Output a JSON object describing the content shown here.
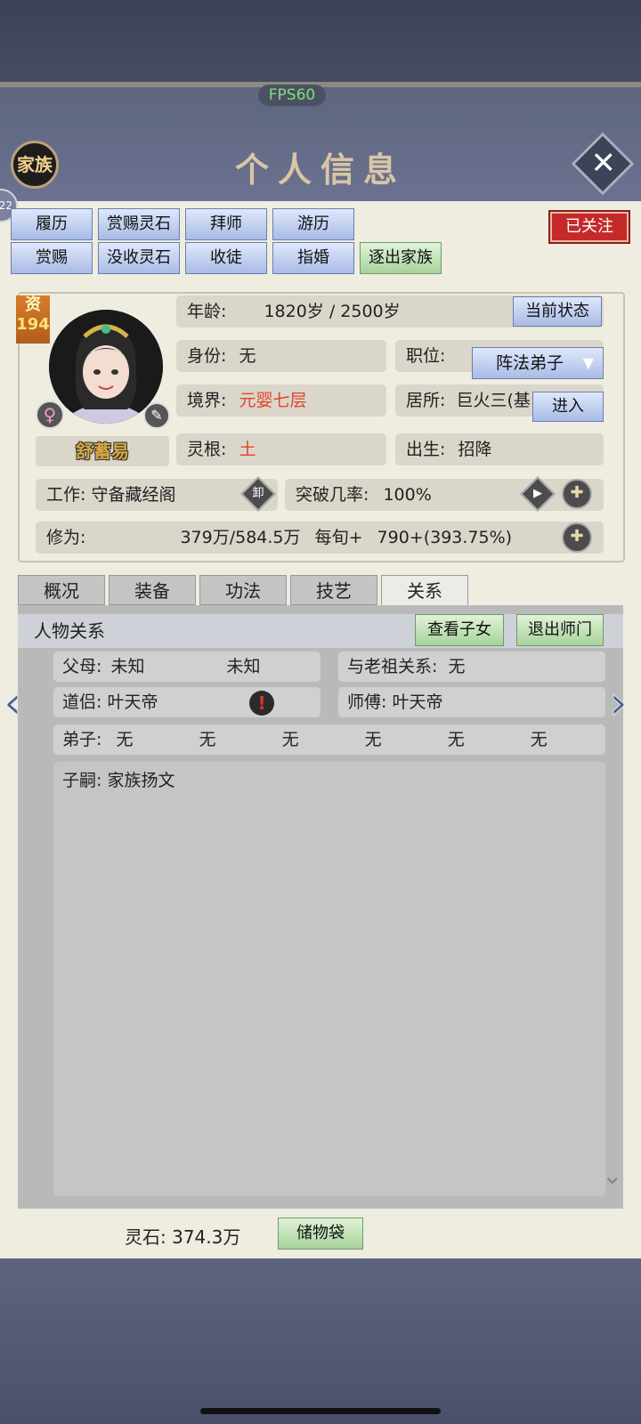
{
  "fps": "FPS60",
  "header": {
    "family_label": "家族",
    "title": "个人信息"
  },
  "side_badge": "22",
  "action_buttons_row1": [
    "履历",
    "赏赐灵石",
    "拜师",
    "游历"
  ],
  "action_buttons_row2": [
    "赏赐",
    "没收灵石",
    "收徒",
    "指婚",
    "逐出家族"
  ],
  "followed_label": "已关注",
  "character": {
    "zi_label": "资",
    "zi_value": "194",
    "gender_icon": "female-icon",
    "name": "舒蓄易",
    "age_label": "年龄:",
    "age_value": "1820岁 / 2500岁",
    "status_button": "当前状态",
    "identity_label": "身份:",
    "identity_value": "无",
    "position_label": "职位:",
    "position_value": "阵法弟子",
    "realm_label": "境界:",
    "realm_value": "元婴七层",
    "residence_label": "居所:",
    "residence_value": "巨火三(基",
    "enter_button": "进入",
    "root_label": "灵根:",
    "root_value": "土",
    "birth_label": "出生:",
    "birth_value": "招降",
    "work_label": "工作:",
    "work_value": "守备藏经阁",
    "work_icon_label": "卸",
    "breakthrough_label": "突破几率:",
    "breakthrough_value": "100%",
    "cultivation_label": "修为:",
    "cultivation_value": "379万/584.5万",
    "per_turn_label": "每旬+",
    "per_turn_value": "790+(393.75%)"
  },
  "tabs": [
    "概况",
    "装备",
    "功法",
    "技艺",
    "关系"
  ],
  "relations": {
    "header": "人物关系",
    "view_children_button": "查看子女",
    "leave_master_button": "退出师门",
    "parents_label": "父母:",
    "parent1": "未知",
    "parent2": "未知",
    "ancestor_label": "与老祖关系:",
    "ancestor_value": "无",
    "partner_label": "道侣:",
    "partner_value": "叶天帝",
    "master_label": "师傅:",
    "master_value": "叶天帝",
    "disciples_label": "弟子:",
    "disciples": [
      "无",
      "无",
      "无",
      "无",
      "无",
      "无"
    ],
    "heirs_label": "子嗣:",
    "heirs_value": "家族扬文"
  },
  "footer": {
    "spirit_stone_label": "灵石:",
    "spirit_stone_value": "374.3万",
    "bag_button": "储物袋"
  },
  "colors": {
    "accent_red": "#e2452c",
    "button_blue": "#a9bbe6",
    "button_green": "#a7d39a",
    "panel": "#efece0"
  }
}
